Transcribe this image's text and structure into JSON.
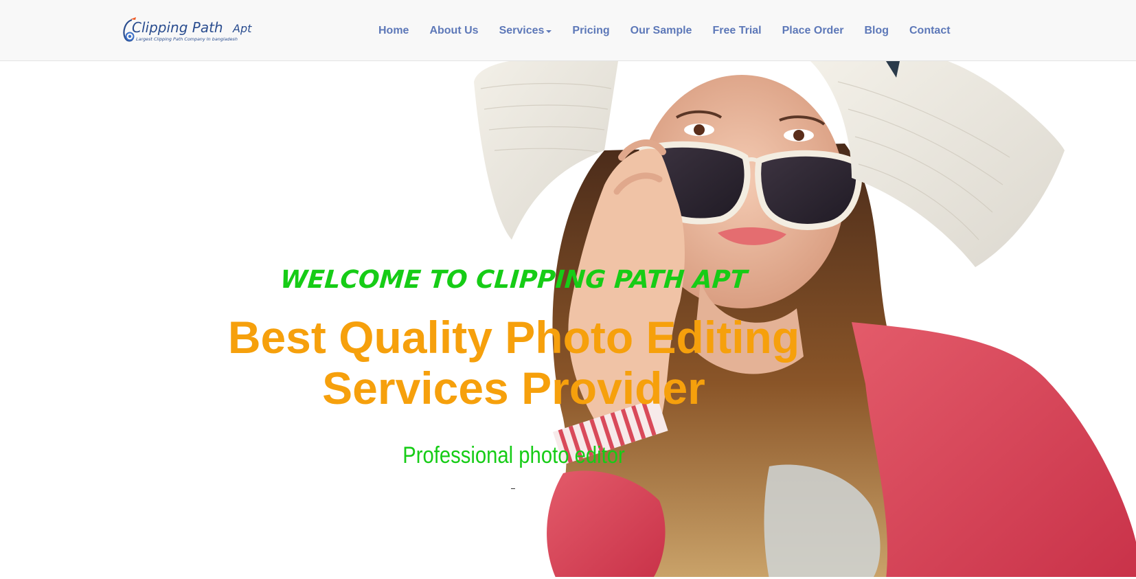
{
  "logo": {
    "name": "Clipping Path",
    "suffix": "Apt",
    "tagline": "Largest Clipping Path Company In bangladesh"
  },
  "nav": {
    "items": [
      {
        "label": "Home"
      },
      {
        "label": "About Us"
      },
      {
        "label": "Services"
      },
      {
        "label": "Pricing"
      },
      {
        "label": "Our Sample"
      },
      {
        "label": "Free Trial"
      },
      {
        "label": "Place Order"
      },
      {
        "label": "Blog"
      },
      {
        "label": "Contact"
      }
    ]
  },
  "hero": {
    "welcome": "WELCOME TO CLIPPING PATH APT",
    "headline_line1": "Best Quality Photo Editing",
    "headline_line2": "Services Provider",
    "subline": "Professional photo editor",
    "dash": "-"
  },
  "colors": {
    "nav_text": "#5d78b8",
    "navbar_bg": "#f8f8f8",
    "welcome": "#16cc16",
    "headline": "#f6a00c",
    "subline": "#16cc16",
    "logo_blue": "#2a4d8f",
    "logo_orange": "#f05a24"
  }
}
